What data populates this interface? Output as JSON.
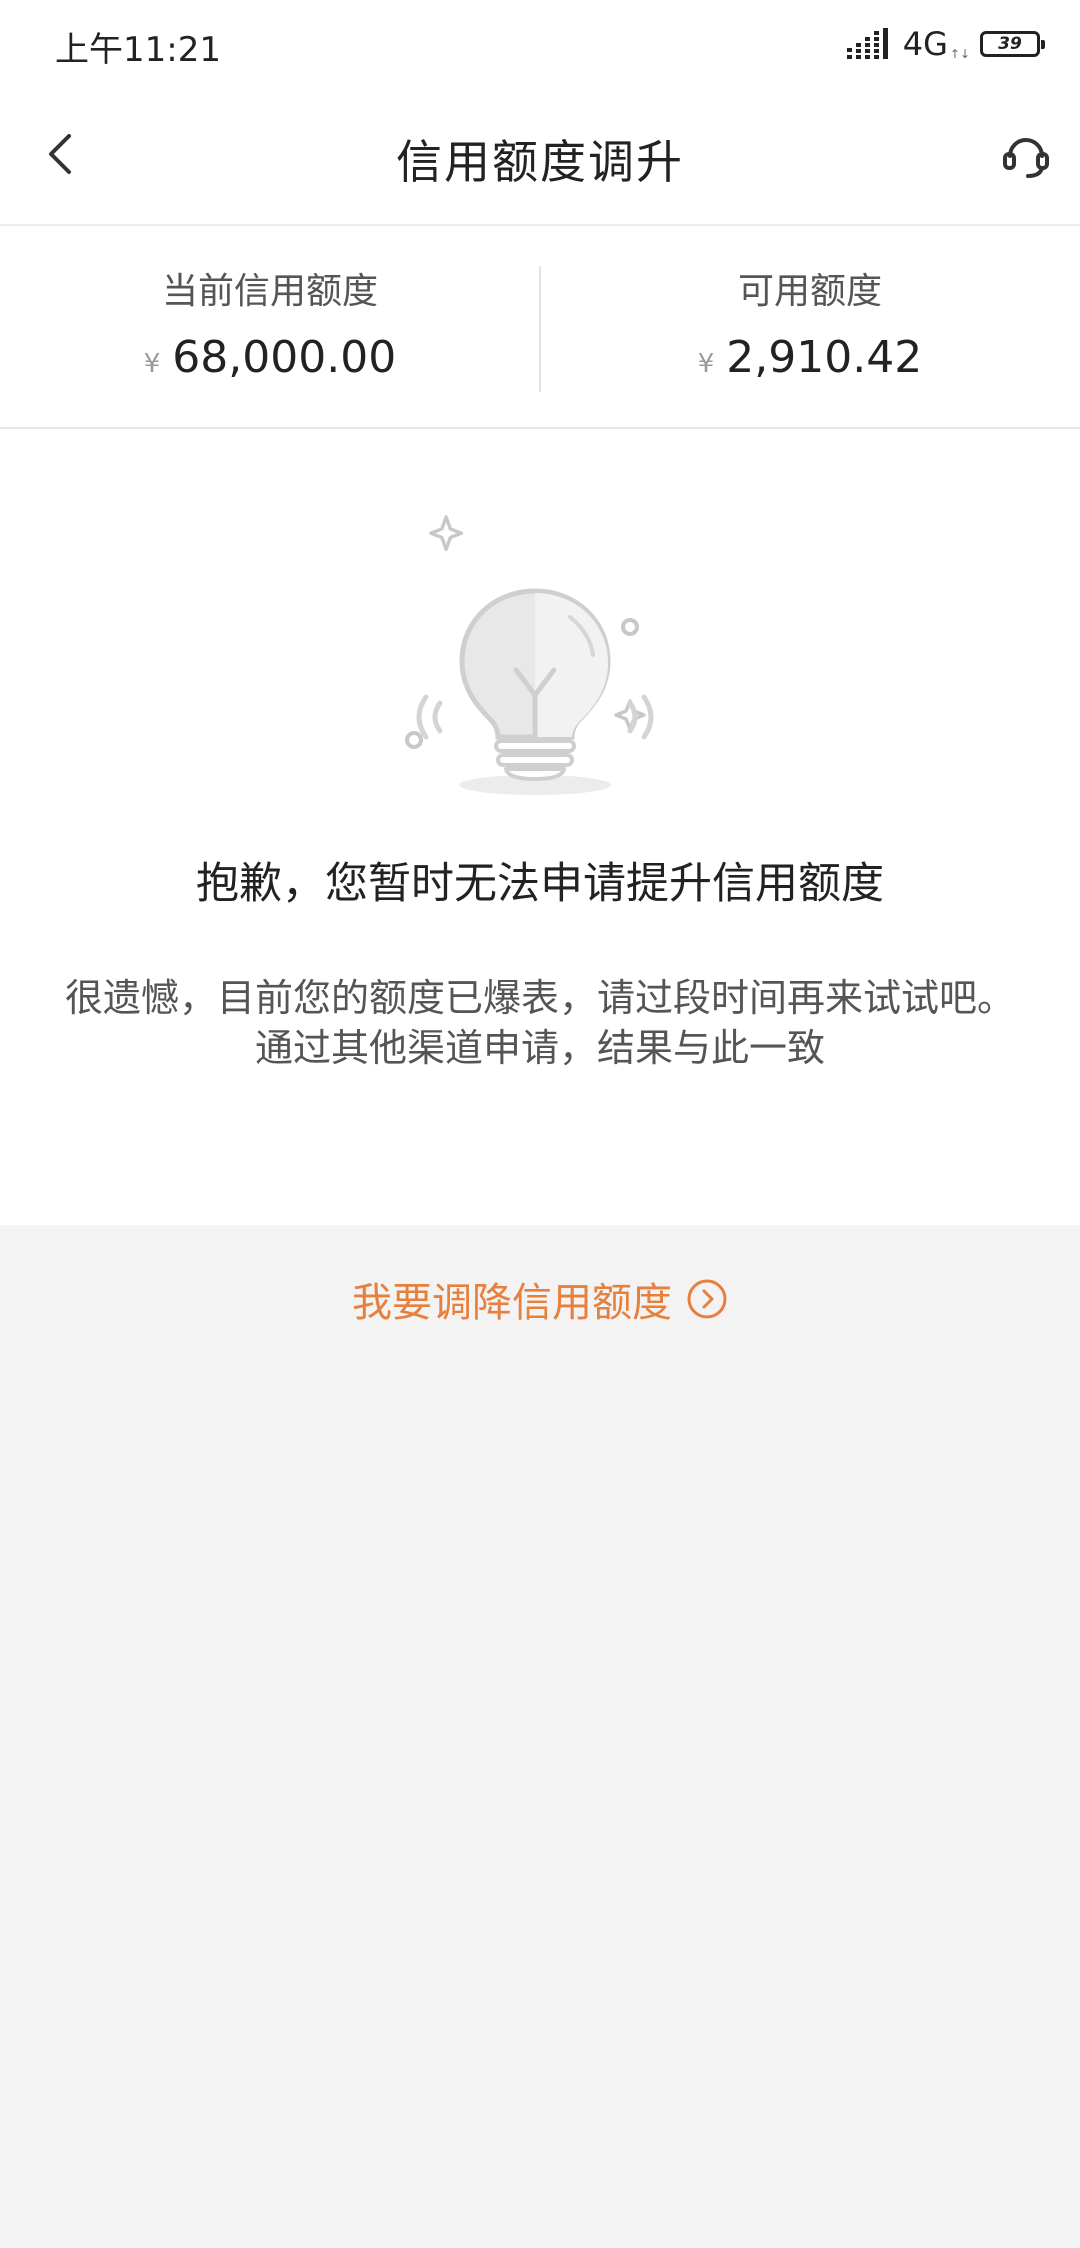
{
  "status_bar": {
    "time": "上午11:21",
    "network": "4G",
    "network_arrows": "↑↓",
    "battery": "39",
    "icons": [
      "signal-icon",
      "battery-icon"
    ]
  },
  "nav": {
    "title": "信用额度调升",
    "back_icon": "chevron-left-icon",
    "service_icon": "headset-icon"
  },
  "summary": {
    "current_label": "当前信用额度",
    "current_currency": "¥",
    "current_amount": "68,000.00",
    "available_label": "可用额度",
    "available_currency": "¥",
    "available_amount": "2,910.42"
  },
  "notice": {
    "illustration_icon": "lightbulb-icon",
    "title": "抱歉，您暂时无法申请提升信用额度",
    "line1": "很遗憾，目前您的额度已爆表，请过段时间再来试试吧。",
    "line2": "通过其他渠道申请，结果与此一致"
  },
  "action": {
    "adjust_label": "我要调降信用额度",
    "adjust_icon": "circle-chevron-right-icon"
  },
  "colors": {
    "accent": "#e6803c",
    "page_background": "#f3f3f3",
    "card_background": "#ffffff"
  }
}
